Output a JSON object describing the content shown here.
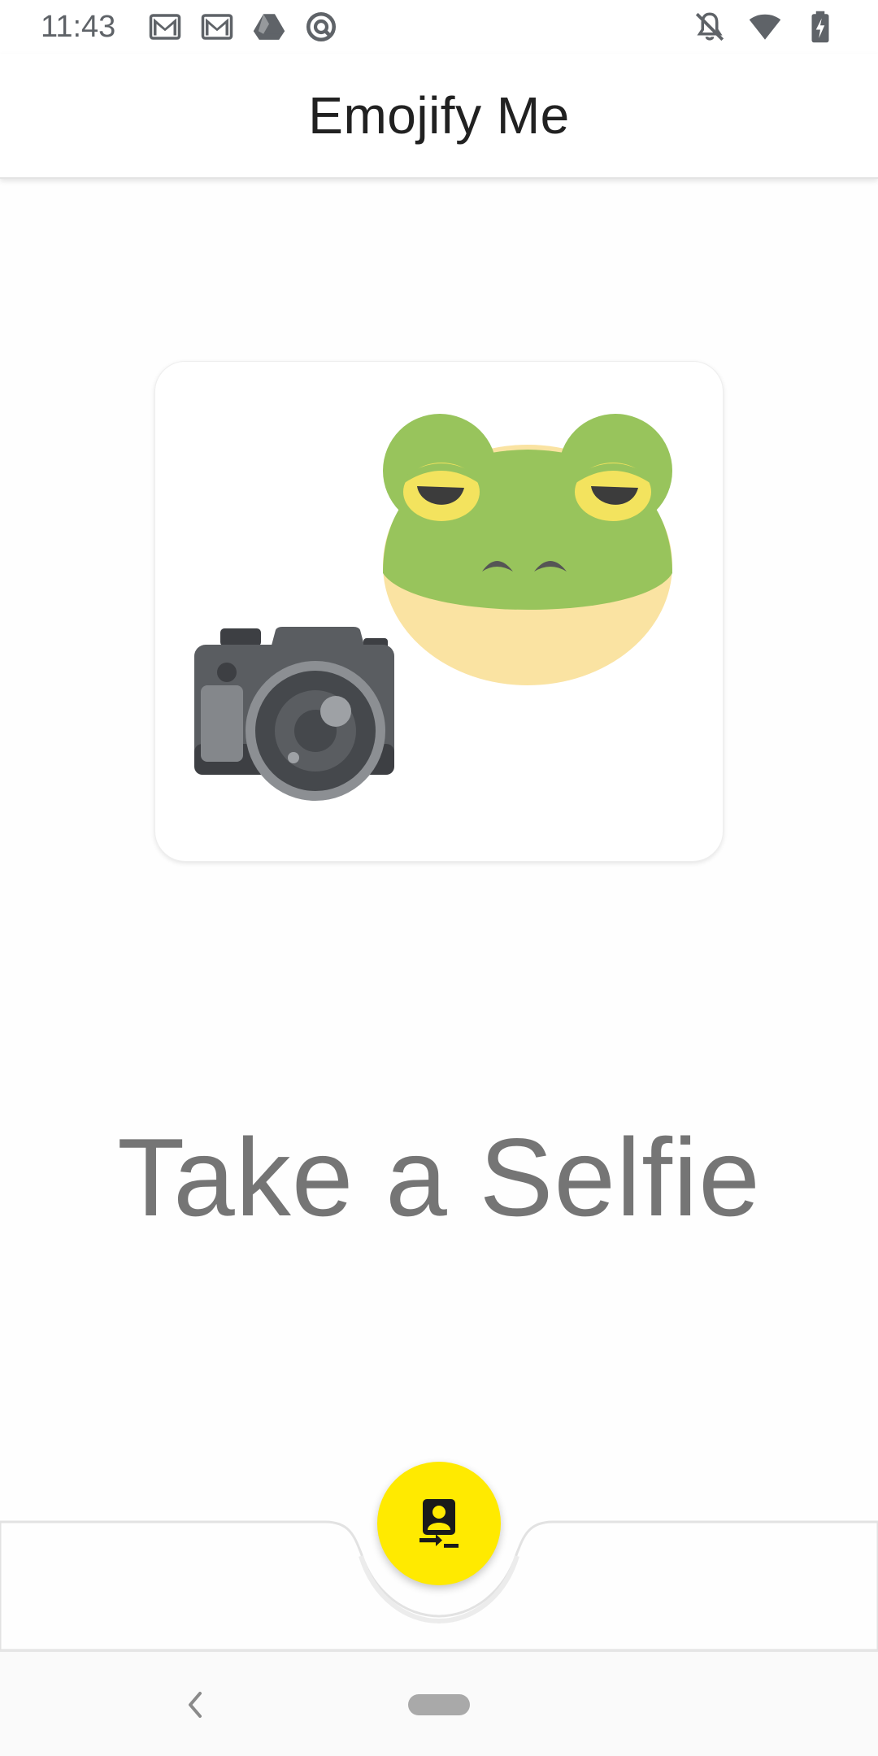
{
  "status_bar": {
    "time": "11:43",
    "left_icons": [
      "gmail-icon",
      "gmail-icon",
      "drive-icon",
      "sync-icon"
    ],
    "right_icons": [
      "notifications-off-icon",
      "wifi-icon",
      "battery-charging-icon"
    ]
  },
  "app_bar": {
    "title": "Emojify Me"
  },
  "main": {
    "card_image": "camera-and-frog-emoji",
    "prompt": "Take a Selfie"
  },
  "fab": {
    "icon": "switch-camera-selfie-icon",
    "color": "#ffea00"
  },
  "nav_bar": {
    "back_icon": "back-chevron-icon",
    "home_icon": "home-pill"
  },
  "colors": {
    "frog_green": "#98c45c",
    "frog_belly": "#fae3a2",
    "frog_eye": "#f3e35e",
    "camera_body": "#5a5d61",
    "title_text": "#212121",
    "prompt_text": "#757575"
  }
}
